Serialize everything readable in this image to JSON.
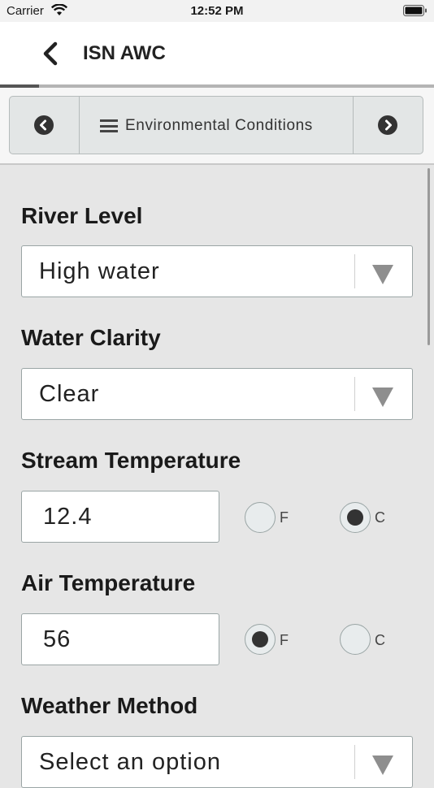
{
  "status_bar": {
    "carrier": "Carrier",
    "time": "12:52 PM"
  },
  "nav": {
    "title": "ISN AWC",
    "progress_fraction": 0.09
  },
  "section_nav": {
    "title": "Environmental Conditions",
    "prev_icon": "chevron-left-circle-icon",
    "next_icon": "chevron-right-circle-icon"
  },
  "form": {
    "river_level": {
      "label": "River Level",
      "value": "High water"
    },
    "water_clarity": {
      "label": "Water Clarity",
      "value": "Clear"
    },
    "stream_temperature": {
      "label": "Stream Temperature",
      "value": "12.4",
      "unit_f": "F",
      "unit_c": "C",
      "selected_unit": "C"
    },
    "air_temperature": {
      "label": "Air Temperature",
      "value": "56",
      "unit_f": "F",
      "unit_c": "C",
      "selected_unit": "F"
    },
    "weather_method": {
      "label": "Weather Method",
      "value": "Select an option"
    }
  },
  "colors": {
    "background": "#e6e6e6",
    "accent_dark": "#333333",
    "border": "#9aa5a5"
  }
}
